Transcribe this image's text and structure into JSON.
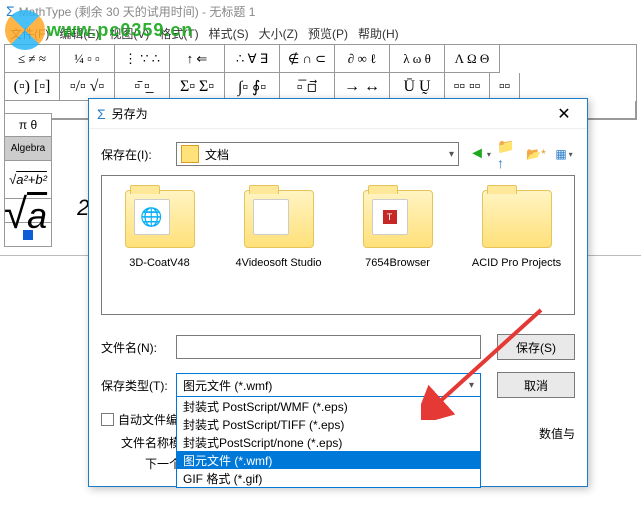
{
  "app": {
    "title": "MathType (剩余 30 天的试用时间) - 无标题 1",
    "watermark": "www.pc0359.cn"
  },
  "menu": {
    "file": "文件(F)",
    "edit": "编辑(E)",
    "view": "视图(V)",
    "format": "格式(T)",
    "style": "样式(S)",
    "size": "大小(Z)",
    "preview": "预览(P)",
    "help": "帮助(H)"
  },
  "toolbar": {
    "r1": [
      "≤ ≠ ≈",
      "¼ ▫ ▫",
      "⋮ ∵ ∴",
      "↑ ⇐",
      "∴ ∀ ∃",
      "∉ ∩ ⊂",
      "∂ ∞ ℓ",
      "λ ω θ",
      "Λ Ω Θ"
    ],
    "r2": [
      "(▫) [▫]",
      "▫/▫ √▫",
      "▫̄ ▫̲",
      "Σ▫ Σ▫",
      "∫▫ ∮▫",
      "▫̅ ▫⃗",
      "→ ↔",
      "Ū Ṵ",
      "▫▫ ▫▫",
      "▫▫"
    ]
  },
  "side": {
    "piu": "π θ",
    "algebra": "Algebra",
    "sqrt_expr": "√(a² + b²)"
  },
  "formula": {
    "main": "√a² +"
  },
  "dialog": {
    "title": "另存为",
    "save_in_label": "保存在(I):",
    "location": "文档",
    "folders": [
      {
        "name": "3D-CoatV48"
      },
      {
        "name": "4Videosoft Studio"
      },
      {
        "name": "7654Browser"
      },
      {
        "name": "ACID Pro Projects"
      }
    ],
    "filename_label": "文件名(N):",
    "filename_value": "",
    "save_btn": "保存(S)",
    "type_label": "保存类型(T):",
    "type_value": "图元文件 (*.wmf)",
    "cancel_btn": "取消",
    "dd": {
      "eps_wmf": "封装式 PostScript/WMF (*.eps)",
      "eps_tiff": "封装式 PostScript/TIFF (*.eps)",
      "eps_none": "封装式PostScript/none (*.eps)",
      "wmf": "图元文件 (*.wmf)",
      "gif": "GIF 格式 (*.gif)"
    },
    "auto_num": "自动文件编号(A)",
    "pattern_label": "文件名称模式 (P",
    "next_label": "下一个编号 (",
    "tail": "数值与"
  }
}
